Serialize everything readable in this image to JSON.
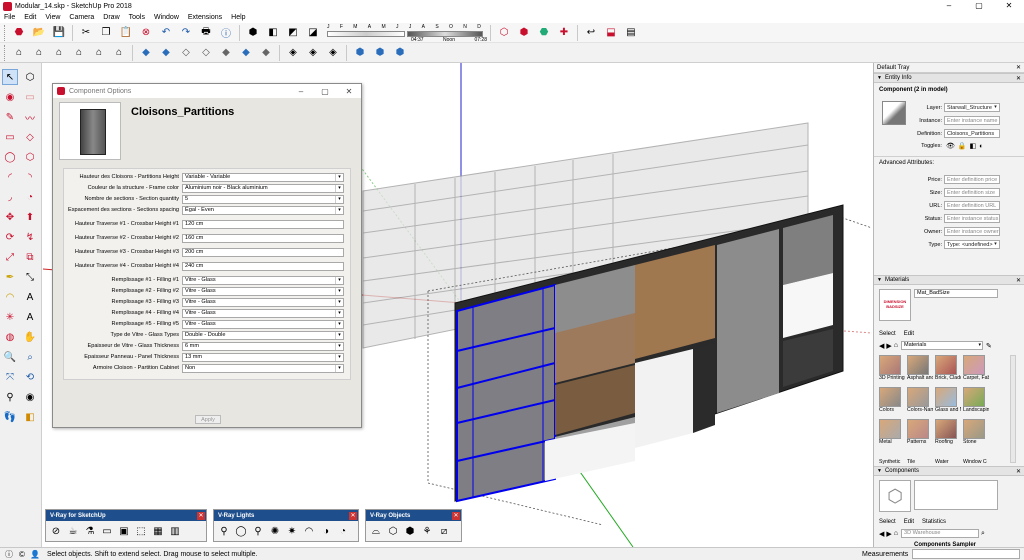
{
  "window": {
    "title": "Modular_14.skp - SketchUp Pro 2018"
  },
  "menu": [
    "File",
    "Edit",
    "View",
    "Camera",
    "Draw",
    "Tools",
    "Window",
    "Extensions",
    "Help"
  ],
  "shadow": {
    "months": [
      "J",
      "F",
      "M",
      "A",
      "M",
      "J",
      "J",
      "A",
      "S",
      "O",
      "N",
      "D"
    ],
    "time_start": "04:37",
    "time_noon": "Noon",
    "time_end": "07:28"
  },
  "dialog": {
    "title": "Component Options",
    "name": "Cloisons_Partitions",
    "fields": [
      {
        "label": "Hauteur des Cloisons - Partitions Height",
        "value": "Variable - Variable",
        "type": "select"
      },
      {
        "label": "Couleur de la structure - Frame color",
        "value": "Aluminium noir - Black aluminium",
        "type": "select"
      },
      {
        "label": "Nombre de sections - Section quantity",
        "value": "5",
        "type": "select"
      },
      {
        "label": "Espacement des sections - Sections spacing",
        "value": "Égal - Even",
        "type": "select"
      },
      {
        "label": "Hauteur Traverse #1 - Crossbar Height #1",
        "value": "120 cm",
        "type": "text"
      },
      {
        "label": "Hauteur Traverse #2 - Crossbar Height #2",
        "value": "160 cm",
        "type": "text"
      },
      {
        "label": "Hauteur Traverse #3 - Crossbar Height #3",
        "value": "200 cm",
        "type": "text"
      },
      {
        "label": "Hauteur Traverse #4 - Crossbar Height #4",
        "value": "240 cm",
        "type": "text"
      },
      {
        "label": "Remplissage #1 - Filling #1",
        "value": "Vitre - Glass",
        "type": "select"
      },
      {
        "label": "Remplissage #2 - Filling #2",
        "value": "Vitre - Glass",
        "type": "select"
      },
      {
        "label": "Remplissage #3 - Filling #3",
        "value": "Vitre - Glass",
        "type": "select"
      },
      {
        "label": "Remplissage #4 - Filling #4",
        "value": "Vitre - Glass",
        "type": "select"
      },
      {
        "label": "Remplissage #5 - Filling #5",
        "value": "Vitre - Glass",
        "type": "select"
      },
      {
        "label": "Type de Vitre - Glass Types",
        "value": "Double - Double",
        "type": "select"
      },
      {
        "label": "Épaisseur de Vitre - Glass Thickness",
        "value": "6 mm",
        "type": "select"
      },
      {
        "label": "Épaisseur Panneau - Panel Thickness",
        "value": "13 mm",
        "type": "select"
      },
      {
        "label": "Armoire Cloison - Partition Cabinet",
        "value": "Non",
        "type": "select"
      }
    ],
    "apply_label": "Apply"
  },
  "vray": [
    {
      "title": "V-Ray for SketchUp"
    },
    {
      "title": "V-Ray Lights"
    },
    {
      "title": "V-Ray Objects"
    }
  ],
  "status": {
    "message": "Select objects. Shift to extend select. Drag mouse to select multiple.",
    "measurements_label": "Measurements",
    "measurements_value": ""
  },
  "tray": {
    "title": "Default Tray",
    "entity_info": {
      "header": "Entity Info",
      "component": "Component (2 in model)",
      "layer_label": "Layer:",
      "layer": "Starwall_Structure",
      "instance_label": "Instance:",
      "instance_placeholder": "Enter instance name",
      "definition_label": "Definition:",
      "definition": "Cloisons_Partitions",
      "toggles_label": "Toggles:",
      "advanced": "Advanced Attributes:",
      "price_label": "Price:",
      "price_ph": "Enter definition price",
      "size_label": "Size:",
      "size_ph": "Enter definition size",
      "url_label": "URL:",
      "url_ph": "Enter definition URL",
      "status_label": "Status:",
      "status_ph": "Enter instance status",
      "owner_label": "Owner:",
      "owner_ph": "Enter instance owner",
      "type_label": "Type:",
      "type": "Type: <undefined>"
    },
    "materials": {
      "header": "Materials",
      "current": "Mat_BadSize",
      "thumb_text": "DIMENSION BADSIZE",
      "tab_select": "Select",
      "tab_edit": "Edit",
      "library": "Materials",
      "items": [
        "3D Printing",
        "Asphalt and",
        "Brick, Cladd",
        "Carpet, Fab",
        "Colors",
        "Colors-Name",
        "Glass and M",
        "Landscaping",
        "Metal",
        "Patterns",
        "Roofing",
        "Stone",
        "Synthetic",
        "Tile",
        "Water",
        "Window Cov"
      ]
    },
    "components": {
      "header": "Components",
      "tab_select": "Select",
      "tab_edit": "Edit",
      "tab_statistics": "Statistics",
      "search_placeholder": "3D Warehouse",
      "sampler": "Components Sampler"
    }
  }
}
